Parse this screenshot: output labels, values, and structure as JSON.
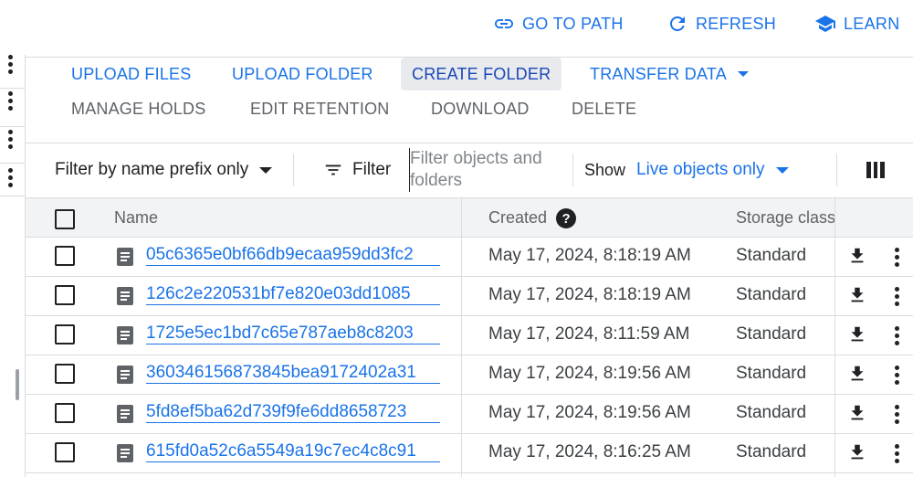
{
  "header": {
    "go_to_path": "GO TO PATH",
    "refresh": "REFRESH",
    "learn": "LEARN"
  },
  "toolbar": {
    "upload_files": "UPLOAD FILES",
    "upload_folder": "UPLOAD FOLDER",
    "create_folder": "CREATE FOLDER",
    "transfer_data": "TRANSFER DATA",
    "manage_holds": "MANAGE HOLDS",
    "edit_retention": "EDIT RETENTION",
    "download": "DOWNLOAD",
    "delete": "DELETE"
  },
  "filter_bar": {
    "prefix_mode": "Filter by name prefix only",
    "filter_label": "Filter",
    "search_placeholder": "Filter objects and folders",
    "show_label": "Show",
    "show_value": "Live objects only"
  },
  "table": {
    "columns": {
      "name": "Name",
      "created": "Created",
      "storage_class": "Storage class"
    },
    "rows": [
      {
        "name": "05c6365e0bf66db9ecaa959dd3fc2",
        "created": "May 17, 2024, 8:18:19 AM",
        "storage_class": "Standard"
      },
      {
        "name": "126c2e220531bf7e820e03dd1085",
        "created": "May 17, 2024, 8:18:19 AM",
        "storage_class": "Standard"
      },
      {
        "name": "1725e5ec1bd7c65e787aeb8c8203",
        "created": "May 17, 2024, 8:11:59 AM",
        "storage_class": "Standard"
      },
      {
        "name": "360346156873845bea9172402a31",
        "created": "May 17, 2024, 8:19:56 AM",
        "storage_class": "Standard"
      },
      {
        "name": "5fd8ef5ba62d739f9fe6dd8658723",
        "created": "May 17, 2024, 8:19:56 AM",
        "storage_class": "Standard"
      },
      {
        "name": "615fd0a52c6a5549a19c7ec4c8c91",
        "created": "May 17, 2024, 8:16:25 AM",
        "storage_class": "Standard"
      }
    ]
  },
  "icons": {
    "go_to_path": "link-icon",
    "refresh": "refresh-icon",
    "learn": "school-icon",
    "filter": "filter-list-icon",
    "columns": "column-toggle-icon",
    "help": "help-icon",
    "file": "file-icon",
    "download": "download-icon",
    "more": "more-vert-icon"
  },
  "colors": {
    "accent": "#1a73e8",
    "active_button_bg": "#e8eaed",
    "disabled_text": "#5f6368",
    "header_bg": "#f1f3f4",
    "divider": "#dadce0"
  }
}
